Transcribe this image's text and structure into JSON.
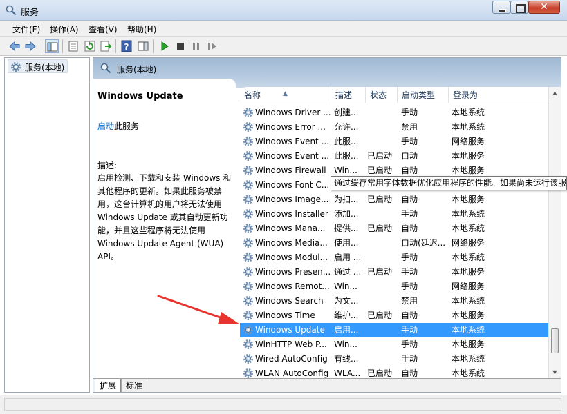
{
  "window": {
    "title": "服务",
    "close_glyph": "✕"
  },
  "menu": [
    "文件(F)",
    "操作(A)",
    "查看(V)",
    "帮助(H)"
  ],
  "toolbar": {
    "icons": [
      "back-icon",
      "forward-icon",
      "show-hide-tree-icon",
      "properties-icon",
      "refresh-icon",
      "export-list-icon",
      "help-icon",
      "action-pane-icon",
      "start-service-icon",
      "stop-service-icon",
      "pause-service-icon",
      "restart-service-icon"
    ]
  },
  "tree": {
    "item_label": "服务(本地)"
  },
  "pane": {
    "header": "服务(本地)"
  },
  "description": {
    "service_title": "Windows Update",
    "start_link": "启动",
    "start_suffix": "此服务",
    "label": "描述:",
    "text": "启用检测、下载和安装 Windows 和其他程序的更新。如果此服务被禁用，这台计算机的用户将无法使用 Windows Update 或其自动更新功能，并且这些程序将无法使用 Windows Update Agent (WUA) API。"
  },
  "columns": {
    "name": "名称",
    "desc": "描述",
    "status": "状态",
    "type": "启动类型",
    "logon": "登录为"
  },
  "services": [
    {
      "name": "Windows Driver ...",
      "desc": "创建...",
      "status": "",
      "type": "手动",
      "logon": "本地系统"
    },
    {
      "name": "Windows Error ...",
      "desc": "允许...",
      "status": "",
      "type": "禁用",
      "logon": "本地系统"
    },
    {
      "name": "Windows Event ...",
      "desc": "此服...",
      "status": "",
      "type": "手动",
      "logon": "网络服务"
    },
    {
      "name": "Windows Event ...",
      "desc": "此服...",
      "status": "已启动",
      "type": "自动",
      "logon": "本地服务"
    },
    {
      "name": "Windows Firewall",
      "desc": "Win...",
      "status": "已启动",
      "type": "自动",
      "logon": "本地服务"
    },
    {
      "name": "Windows Font C...",
      "desc": "",
      "status": "",
      "type": "",
      "logon": ""
    },
    {
      "name": "Windows Image...",
      "desc": "为扫...",
      "status": "已启动",
      "type": "自动",
      "logon": "本地服务"
    },
    {
      "name": "Windows Installer",
      "desc": "添加...",
      "status": "",
      "type": "手动",
      "logon": "本地系统"
    },
    {
      "name": "Windows Mana...",
      "desc": "提供...",
      "status": "已启动",
      "type": "自动",
      "logon": "本地系统"
    },
    {
      "name": "Windows Media...",
      "desc": "使用...",
      "status": "",
      "type": "自动(延迟...",
      "logon": "网络服务"
    },
    {
      "name": "Windows Modul...",
      "desc": "启用 ...",
      "status": "",
      "type": "手动",
      "logon": "本地系统"
    },
    {
      "name": "Windows Presen...",
      "desc": "通过 ...",
      "status": "已启动",
      "type": "手动",
      "logon": "本地服务"
    },
    {
      "name": "Windows Remot...",
      "desc": "Win...",
      "status": "",
      "type": "手动",
      "logon": "网络服务"
    },
    {
      "name": "Windows Search",
      "desc": "为文...",
      "status": "",
      "type": "禁用",
      "logon": "本地系统"
    },
    {
      "name": "Windows Time",
      "desc": "维护...",
      "status": "已启动",
      "type": "自动",
      "logon": "本地服务"
    },
    {
      "name": "Windows Update",
      "desc": "启用...",
      "status": "",
      "type": "手动",
      "logon": "本地系统",
      "selected": true
    },
    {
      "name": "WinHTTP Web P...",
      "desc": "Win...",
      "status": "",
      "type": "手动",
      "logon": "本地服务"
    },
    {
      "name": "Wired AutoConfig",
      "desc": "有线...",
      "status": "",
      "type": "手动",
      "logon": "本地系统"
    },
    {
      "name": "WLAN AutoConfig",
      "desc": "WLA...",
      "status": "已启动",
      "type": "自动",
      "logon": "本地系统"
    }
  ],
  "tooltip": "通过缓存常用字体数据优化应用程序的性能。如果尚未运行该服",
  "tabs": [
    "扩展",
    "标准"
  ],
  "colors": {
    "selection": "#3399ff",
    "annotation_arrow": "#e8332e",
    "link": "#0066cc"
  }
}
